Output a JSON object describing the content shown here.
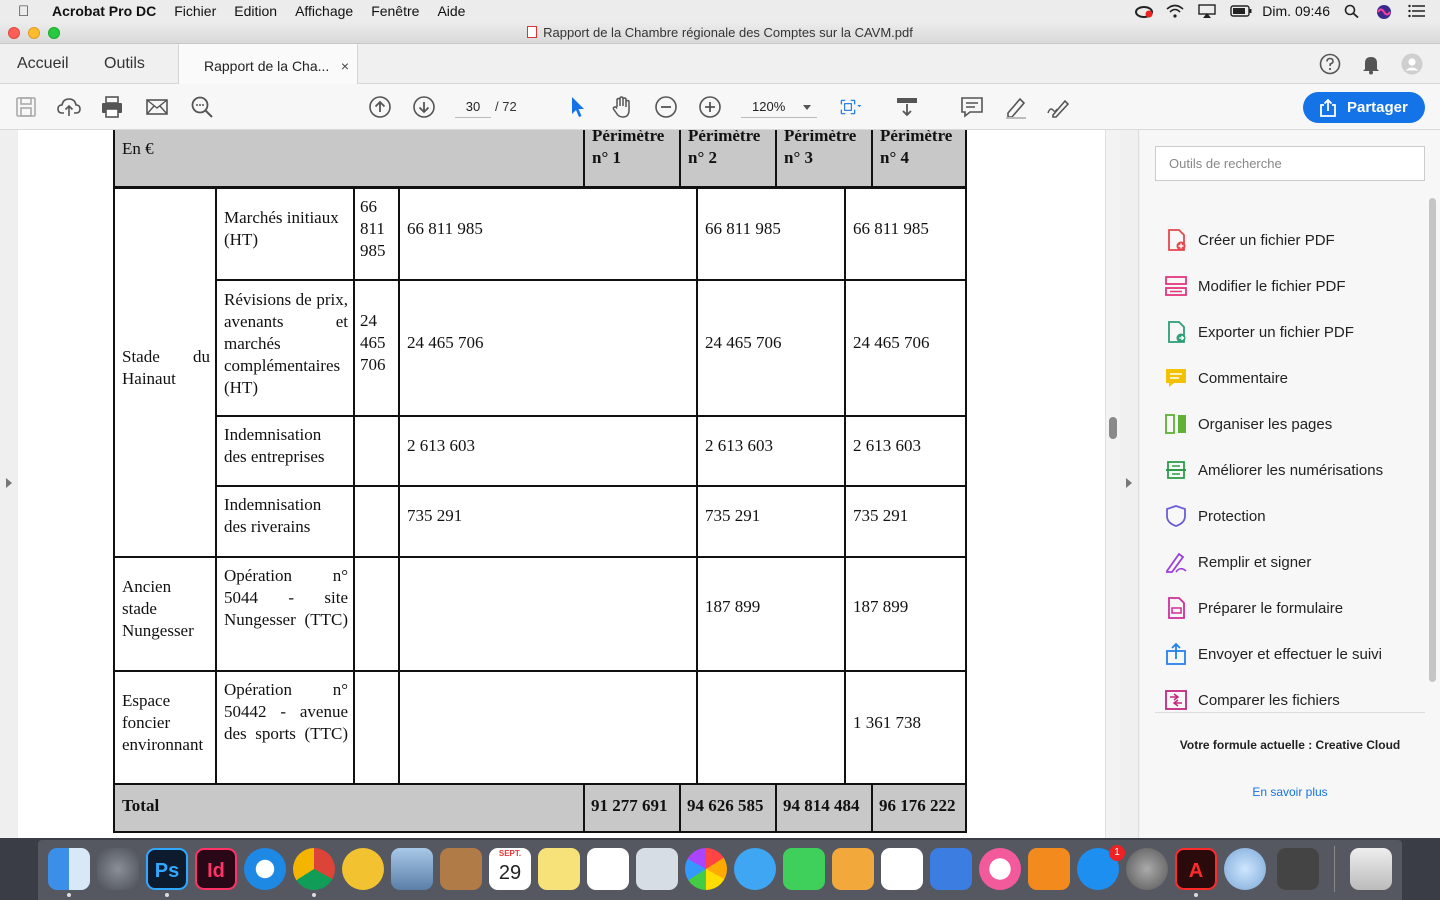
{
  "menubar": {
    "app": "Acrobat Pro DC",
    "items": [
      "Fichier",
      "Edition",
      "Affichage",
      "Fenêtre",
      "Aide"
    ],
    "clock": "Dim. 09:46"
  },
  "window": {
    "title": "Rapport de la Chambre régionale des Comptes sur la CAVM.pdf"
  },
  "tabs": {
    "home": "Accueil",
    "tools": "Outils",
    "document": "Rapport de la Cha...",
    "close": "×"
  },
  "toolbar": {
    "page_current": "30",
    "page_total": "/ 72",
    "zoom": "120%",
    "share_label": "Partager"
  },
  "table": {
    "header": {
      "unit": "En €",
      "p1": "Périmètre n° 1",
      "p2": "Périmètre n° 2",
      "p3": "Périmètre n° 3",
      "p4": "Périmètre n° 4"
    },
    "groups": [
      {
        "name": "Stade du Hainaut"
      },
      {
        "name": "Ancien stade Nungesser"
      },
      {
        "name": "Espace foncier environnant"
      }
    ],
    "rows": [
      {
        "label": "Marchés initiaux (HT)",
        "c1": "66 811 985",
        "c2": "66 811 985",
        "c3": "66 811 985",
        "c4": "66 811 985"
      },
      {
        "label": "Révisions de prix, avenants et marchés complémentaires (HT)",
        "c1": "24 465 706",
        "c2": "24 465 706",
        "c3": "24 465 706",
        "c4": "24 465 706"
      },
      {
        "label": "Indemnisation des entreprises",
        "c1": "",
        "c2": "2 613 603",
        "c3": "2 613 603",
        "c4": "2 613 603"
      },
      {
        "label": "Indemnisation des riverains",
        "c1": "",
        "c2": "735 291",
        "c3": "735 291",
        "c4": "735 291"
      },
      {
        "label": "Opération n° 5044 - site Nungesser (TTC)",
        "c1": "",
        "c2": "",
        "c3": "187 899",
        "c4": "187 899"
      },
      {
        "label": "Opération n° 50442 - avenue des sports (TTC)",
        "c1": "",
        "c2": "",
        "c3": "",
        "c4": "1 361 738"
      }
    ],
    "total": {
      "label": "Total",
      "p1": "91 277 691",
      "p2": "94 626 585",
      "p3": "94 814 484",
      "p4": "96 176 222"
    }
  },
  "right_panel": {
    "search_placeholder": "Outils de recherche",
    "tools": [
      {
        "label": "Créer un fichier PDF",
        "icon": "create-pdf-icon",
        "color": "#e34850"
      },
      {
        "label": "Modifier le fichier PDF",
        "icon": "edit-pdf-icon",
        "color": "#e1377d"
      },
      {
        "label": "Exporter un fichier PDF",
        "icon": "export-pdf-icon",
        "color": "#2d9d78"
      },
      {
        "label": "Commentaire",
        "icon": "comment-icon",
        "color": "#f2c200"
      },
      {
        "label": "Organiser les pages",
        "icon": "organize-pages-icon",
        "color": "#5eb135"
      },
      {
        "label": "Améliorer les numérisations",
        "icon": "enhance-scans-icon",
        "color": "#2d9d4b"
      },
      {
        "label": "Protection",
        "icon": "protect-shield-icon",
        "color": "#6a5fd3"
      },
      {
        "label": "Remplir et signer",
        "icon": "fill-sign-icon",
        "color": "#9b3fd6"
      },
      {
        "label": "Préparer le formulaire",
        "icon": "prepare-form-icon",
        "color": "#d02e9a"
      },
      {
        "label": "Envoyer et effectuer le suivi",
        "icon": "send-track-icon",
        "color": "#2680eb"
      },
      {
        "label": "Comparer les fichiers",
        "icon": "compare-files-icon",
        "color": "#c4267d"
      }
    ],
    "plan": "Votre formule actuelle : Creative Cloud",
    "learn_more": "En savoir plus"
  },
  "dock": {
    "calendar_month": "SEPT.",
    "calendar_day": "29",
    "appstore_badge": "1",
    "apps": [
      "Finder",
      "Launchpad",
      "Photoshop",
      "InDesign",
      "Safari",
      "Chrome",
      "Cyberduck",
      "Aperçu",
      "Contacts",
      "Calendrier",
      "Notes",
      "Rappels",
      "Photo Booth",
      "Photos",
      "Messages",
      "FaceTime",
      "Pages",
      "Numbers",
      "Keynote",
      "iTunes",
      "iBooks",
      "App Store",
      "Préférences Système",
      "Acrobat",
      "Utilitaire",
      "Disque",
      "Corbeille"
    ]
  }
}
